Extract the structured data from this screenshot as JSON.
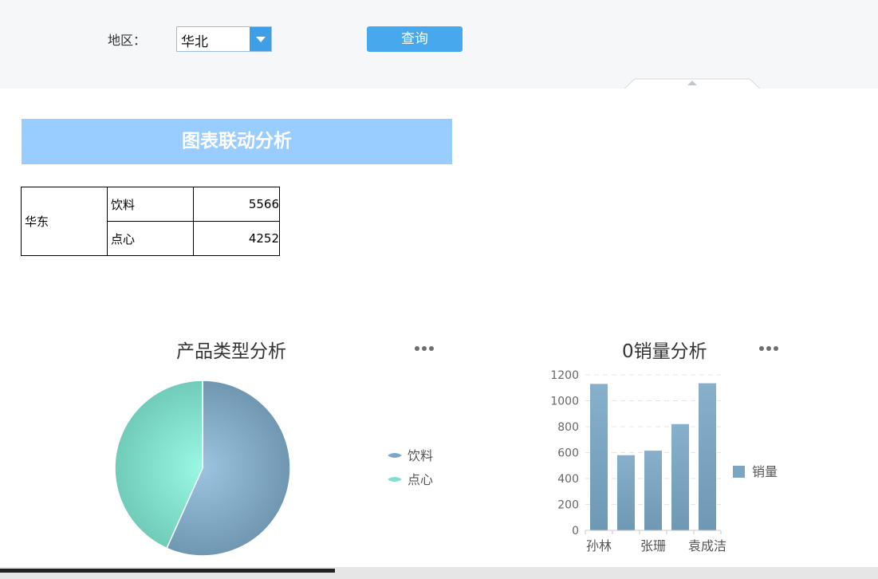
{
  "query": {
    "region_label": "地区：",
    "region_value": "华北",
    "query_button": "查询"
  },
  "banner": {
    "title": "图表联动分析"
  },
  "table": {
    "region": "华东",
    "rows": [
      {
        "type": "饮料",
        "value": "5566"
      },
      {
        "type": "点心",
        "value": "4252"
      }
    ]
  },
  "colors": {
    "accent": "#47a8ee",
    "banner": "#99ccff",
    "bar": "#7ba6c2",
    "slice_drink": "#7ea7c4",
    "slice_snack": "#80e0cc"
  },
  "chart_data": [
    {
      "type": "pie",
      "title": "产品类型分析",
      "legend_position": "right",
      "slices": [
        {
          "name": "饮料",
          "value": 5566,
          "color": "#7ea7c4"
        },
        {
          "name": "点心",
          "value": 4252,
          "color": "#80e0cc"
        }
      ]
    },
    {
      "type": "bar",
      "title": "0销量分析",
      "categories": [
        "孙林",
        "",
        "张珊",
        "",
        "袁成洁"
      ],
      "series": [
        {
          "name": "销量",
          "values": [
            1130,
            580,
            615,
            820,
            1135
          ]
        }
      ],
      "ylim": [
        0,
        1200
      ],
      "yticks": [
        0,
        200,
        400,
        600,
        800,
        1000,
        1200
      ],
      "grid": true,
      "legend_position": "right"
    }
  ]
}
